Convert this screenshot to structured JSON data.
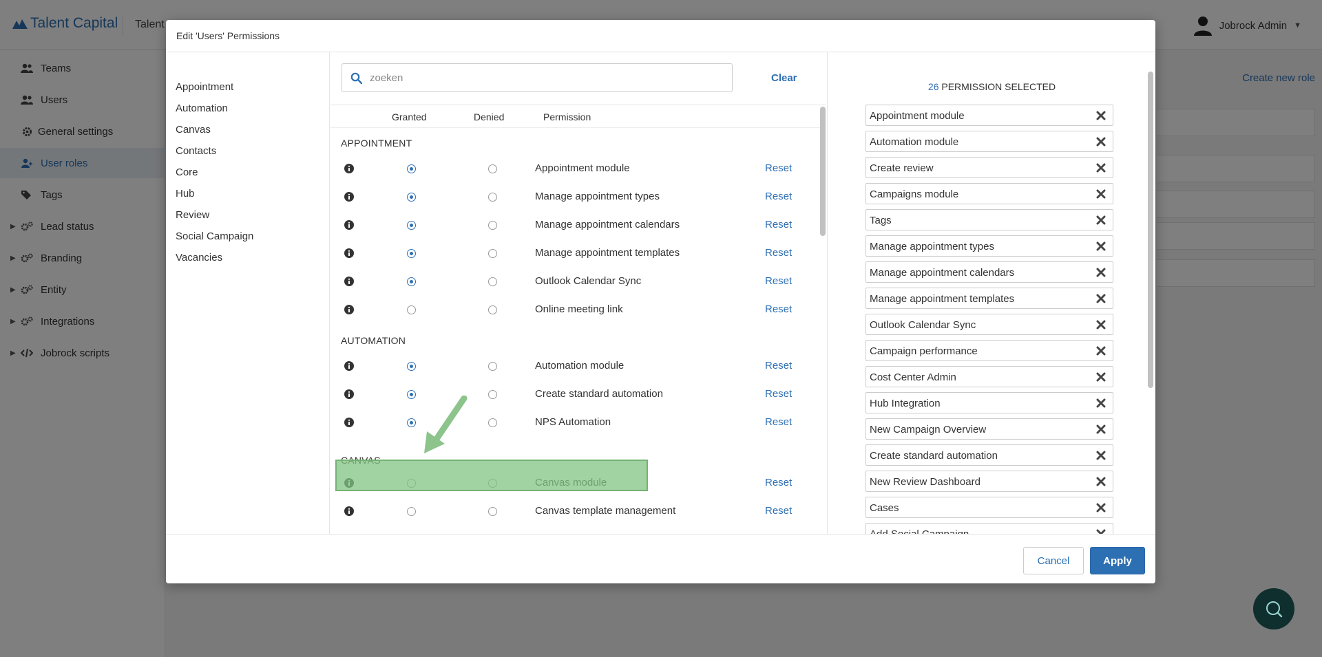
{
  "app": {
    "logo": "Talent Capital",
    "title": "Talent"
  },
  "user": {
    "name": "Jobrock Admin"
  },
  "sidebar": {
    "items": [
      {
        "label": "Teams",
        "icon": "users-icon"
      },
      {
        "label": "Users",
        "icon": "users-icon"
      },
      {
        "label": "General settings",
        "icon": "gear-icon"
      },
      {
        "label": "User roles",
        "icon": "user-role-icon"
      },
      {
        "label": "Tags",
        "icon": "tags-icon"
      },
      {
        "label": "Lead status",
        "icon": "gears-icon"
      },
      {
        "label": "Branding",
        "icon": "gears-icon"
      },
      {
        "label": "Entity",
        "icon": "gears-icon"
      },
      {
        "label": "Integrations",
        "icon": "gears-icon"
      },
      {
        "label": "Jobrock scripts",
        "icon": "code-icon"
      }
    ]
  },
  "background": {
    "create_link": "Create new role"
  },
  "modal": {
    "title": "Edit 'Users' Permissions",
    "categories": [
      "Appointment",
      "Automation",
      "Canvas",
      "Contacts",
      "Core",
      "Hub",
      "Review",
      "Social Campaign",
      "Vacancies"
    ],
    "search": {
      "placeholder": "zoeken",
      "clear_label": "Clear"
    },
    "columns": {
      "granted": "Granted",
      "denied": "Denied",
      "permission": "Permission"
    },
    "reset_label": "Reset",
    "groups": [
      {
        "title": "APPOINTMENT",
        "rows": [
          {
            "label": "Appointment module",
            "state": "granted"
          },
          {
            "label": "Manage appointment types",
            "state": "granted"
          },
          {
            "label": "Manage appointment calendars",
            "state": "granted"
          },
          {
            "label": "Manage appointment templates",
            "state": "granted"
          },
          {
            "label": "Outlook Calendar Sync",
            "state": "granted"
          },
          {
            "label": "Online meeting link",
            "state": "none"
          }
        ]
      },
      {
        "title": "AUTOMATION",
        "rows": [
          {
            "label": "Automation module",
            "state": "granted"
          },
          {
            "label": "Create standard automation",
            "state": "granted"
          },
          {
            "label": "NPS Automation",
            "state": "granted"
          }
        ]
      },
      {
        "title": "CANVAS",
        "rows": [
          {
            "label": "Canvas module",
            "state": "none"
          },
          {
            "label": "Canvas template management",
            "state": "none"
          }
        ]
      }
    ],
    "selected": {
      "count": "26",
      "count_suffix": "PERMISSION SELECTED",
      "items": [
        "Appointment module",
        "Automation module",
        "Create review",
        "Campaigns module",
        "Tags",
        "Manage appointment types",
        "Manage appointment calendars",
        "Manage appointment templates",
        "Outlook Calendar Sync",
        "Campaign performance",
        "Cost Center Admin",
        "Hub Integration",
        "New Campaign Overview",
        "Create standard automation",
        "New Review Dashboard",
        "Cases",
        "Add Social Campaign"
      ]
    },
    "footer": {
      "cancel_label": "Cancel",
      "apply_label": "Apply"
    }
  },
  "colors": {
    "accent": "#2d6fb3",
    "highlight": "#82c382",
    "chat": "#0f2e2e"
  }
}
